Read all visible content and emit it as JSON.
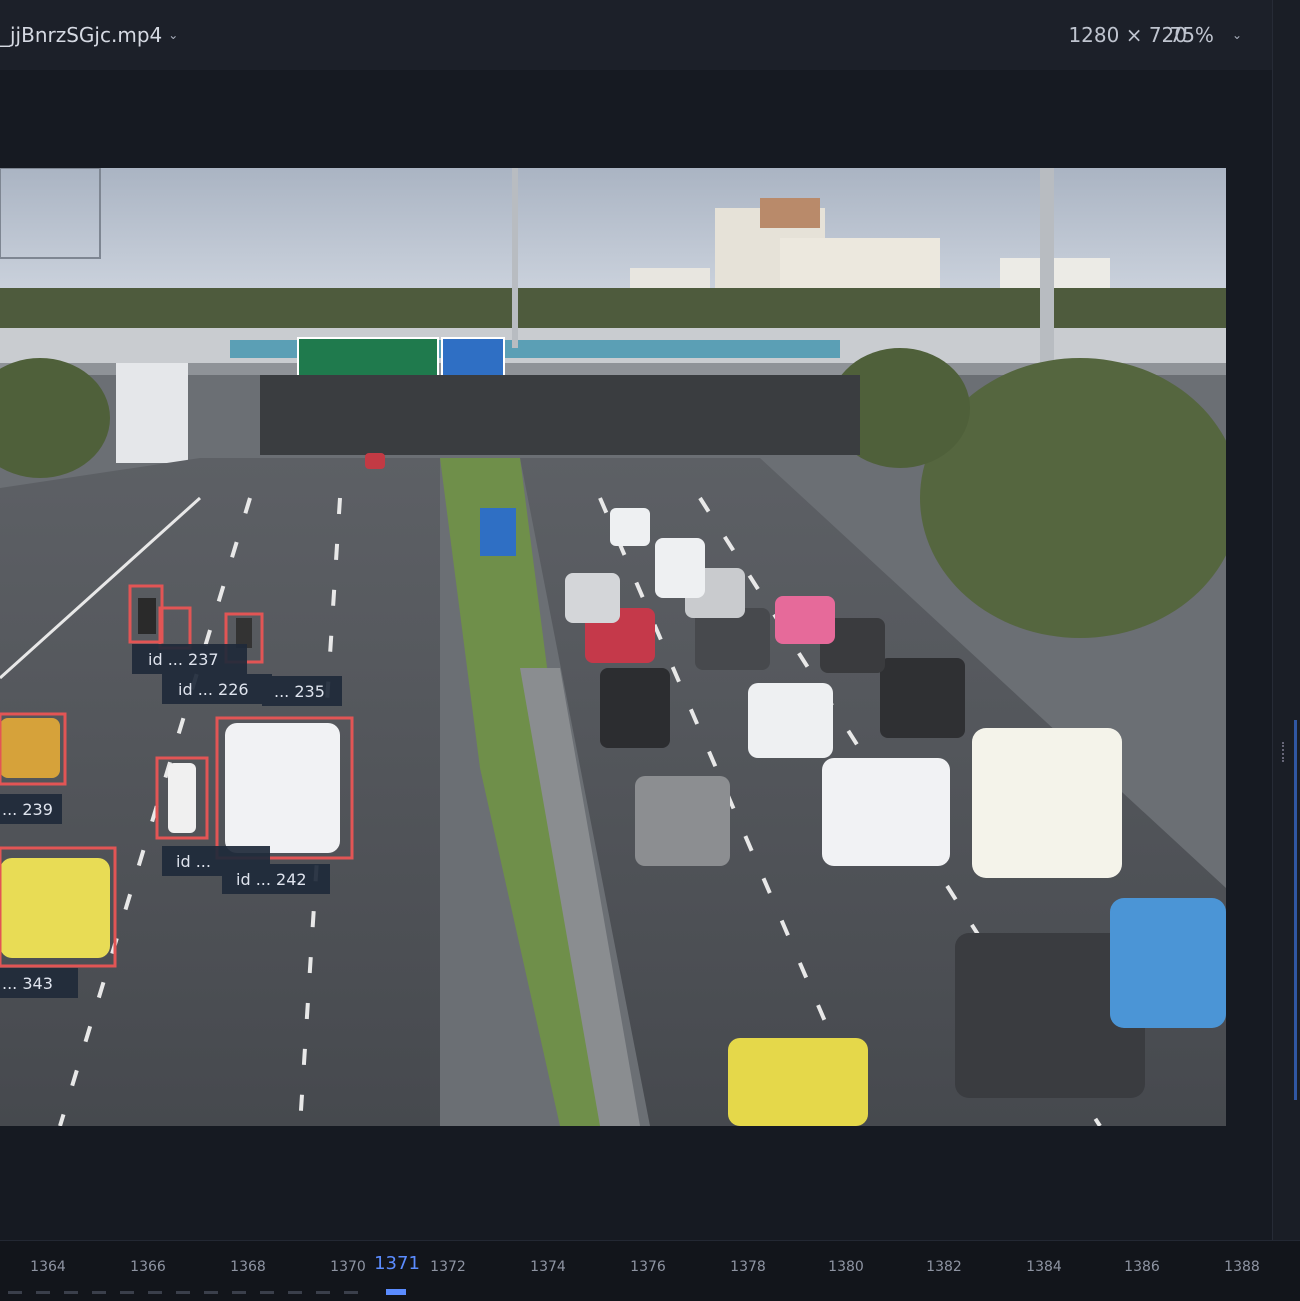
{
  "header": {
    "file_name": "_jjBnrzSGjc.mp4",
    "resolution": "1280 × 720",
    "zoom": "75%"
  },
  "detections": [
    {
      "label": "id ... 237",
      "color": "#e25555"
    },
    {
      "label": "id ... 226",
      "color": "#e25555"
    },
    {
      "label": "... 235",
      "color": "#e25555"
    },
    {
      "label": "... 239",
      "color": "#e25555"
    },
    {
      "label": "id ...",
      "color": "#e25555"
    },
    {
      "label": "id ... 242",
      "color": "#e25555"
    },
    {
      "label": "... 343",
      "color": "#e25555"
    }
  ],
  "timeline": {
    "current_frame": "1371",
    "ticks": [
      "1364",
      "1366",
      "1368",
      "1370",
      "1372",
      "1374",
      "1376",
      "1378",
      "1380",
      "1382",
      "1384",
      "1386",
      "1388"
    ]
  },
  "colors": {
    "accent": "#5b8cff",
    "box": "#e25555",
    "background": "#15181f"
  }
}
